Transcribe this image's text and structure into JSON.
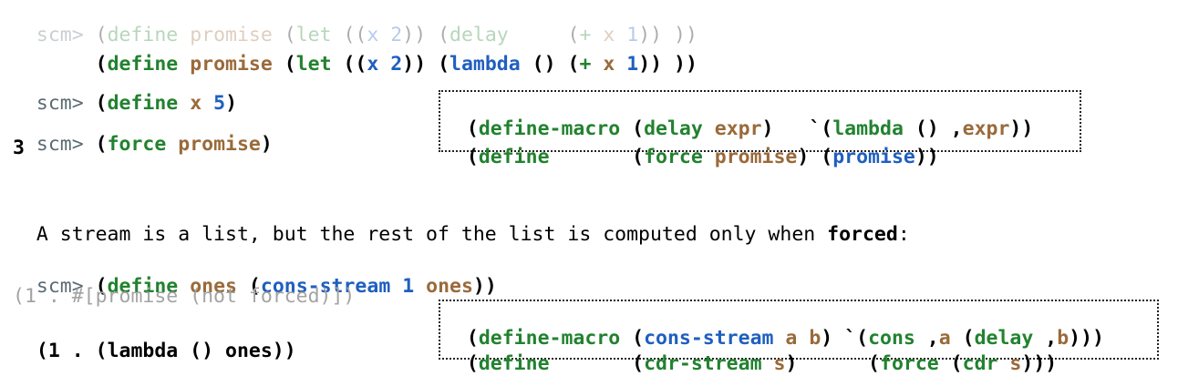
{
  "prompt": "scm>",
  "faded_define_line": [
    "(",
    "define",
    " ",
    "promise",
    " (",
    "let",
    " ((",
    "x",
    " ",
    "2",
    ")) (",
    "delay",
    "     (",
    "+",
    " ",
    "x",
    " ",
    "1",
    ")) ))"
  ],
  "define_promise_line": [
    "(",
    "define",
    " ",
    "promise",
    " (",
    "let",
    " ((",
    "x",
    " ",
    "2",
    ")) (",
    "lambda",
    " () (",
    "+",
    " ",
    "x",
    " ",
    "1",
    ")) ))"
  ],
  "define_x_line": [
    "(",
    "define",
    " ",
    "x",
    " ",
    "5",
    ")"
  ],
  "force_line": [
    "(",
    "force",
    " ",
    "promise",
    ")"
  ],
  "force_result": "3",
  "box1_line1": [
    "(",
    "define-macro",
    " (",
    "delay",
    " ",
    "expr",
    ")   `(",
    "lambda",
    " () ,",
    "expr",
    "))"
  ],
  "box1_line2": [
    "(",
    "define",
    "       (",
    "force",
    " ",
    "promise",
    ") (",
    "promise",
    "))"
  ],
  "stream_sentence": {
    "before": "A stream is a list, but the rest of the list is computed only when ",
    "bold": "forced",
    "after": ":"
  },
  "define_ones_line": [
    "(",
    "define",
    " ",
    "ones",
    " (",
    "cons-stream",
    " ",
    "1",
    " ",
    "ones",
    "))"
  ],
  "faded_result": "(1 . #[promise (not forced)])",
  "ones_result": [
    "(1 . (",
    "lambda",
    " () ",
    "ones",
    "))"
  ],
  "box2_line1": [
    "(",
    "define-macro",
    " (",
    "cons-stream",
    " ",
    "a",
    " ",
    "b",
    ") `(",
    "cons",
    " ,",
    "a",
    " (",
    "delay",
    " ,",
    "b",
    ")))"
  ],
  "box2_line2": [
    "(",
    "define",
    "       (",
    "cdr-stream",
    " ",
    "s",
    ")      (",
    "force",
    " (",
    "cdr",
    " ",
    "s",
    ")))"
  ]
}
